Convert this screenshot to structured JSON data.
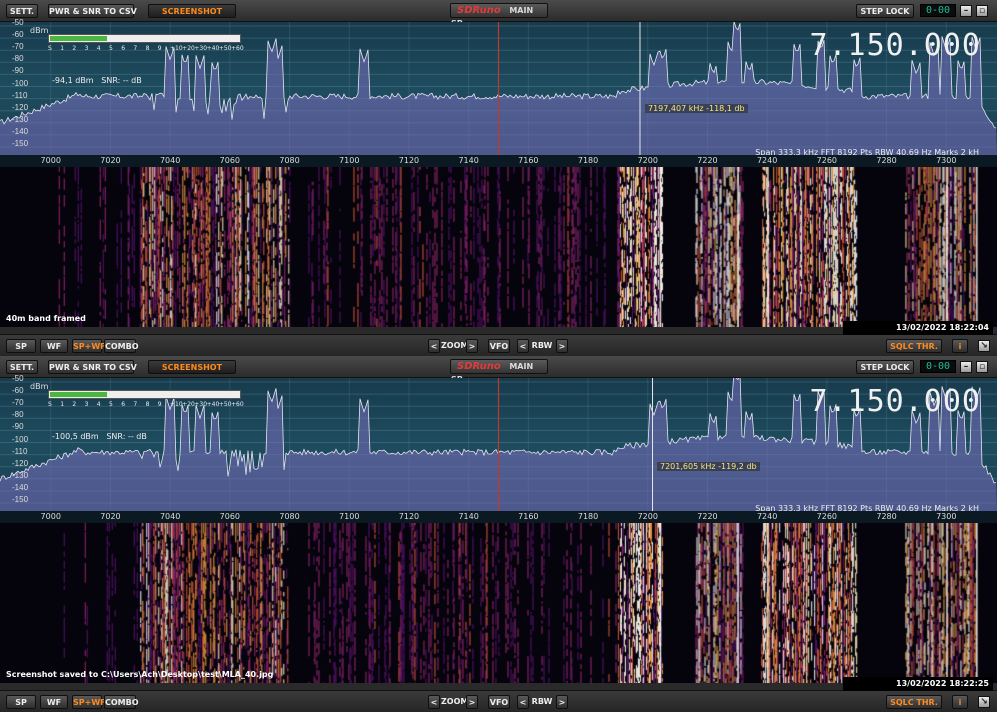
{
  "panels": [
    {
      "toolbar": {
        "settings_label": "SETT.",
        "pwr_snr_label": "PWR & SNR TO CSV",
        "screenshot_label": "SCREENSHOT",
        "logo_text": "SDRuno",
        "main_sp_label": "MAIN SP",
        "step_lock_label": "STEP LOCK",
        "segment_display": "0-00"
      },
      "spectrum": {
        "frequency_display": "7.150.000",
        "dbm_label": "dBm",
        "meter_scale": [
          "S",
          "1",
          "2",
          "3",
          "4",
          "5",
          "6",
          "7",
          "8",
          "9",
          "+10",
          "+20",
          "+30",
          "+40",
          "+50",
          "+60"
        ],
        "meter_level": 0.3,
        "level_readout": "-94,1 dBm",
        "snr_readout": "SNR: -- dB",
        "cursor_readout": "7197,407 kHz -118,1 db",
        "info_line": "Span 333,3 kHz   FFT 8192 Pts   RBW 40,69 Hz   Marks 2 kH",
        "db_scale": [
          "-50",
          "-60",
          "-70",
          "-80",
          "-90",
          "-100",
          "-110",
          "-120",
          "-130",
          "-140",
          "-150"
        ],
        "freq_axis": [
          "7000",
          "7020",
          "7040",
          "7060",
          "7080",
          "7100",
          "7120",
          "7140",
          "7160",
          "7180",
          "7200",
          "7220",
          "7240",
          "7260",
          "7280",
          "7300"
        ],
        "cursor_freq_khz": 7197.4
      },
      "waterfall": {
        "caption": "40m band framed",
        "timestamp": "13/02/2022 18:22:04"
      },
      "bottom": {
        "sp_label": "SP",
        "wf_label": "WF",
        "spwf_label": "SP+WF",
        "combo_label": "COMBO",
        "zoom_label": "ZOOM",
        "vfo_label": "VFO",
        "rbw_label": "RBW",
        "sqlc_label": "SQLC THR.",
        "info_label": "i"
      }
    },
    {
      "toolbar": {
        "settings_label": "SETT.",
        "pwr_snr_label": "PWR & SNR TO CSV",
        "screenshot_label": "SCREENSHOT",
        "logo_text": "SDRuno",
        "main_sp_label": "MAIN SP",
        "step_lock_label": "STEP LOCK",
        "segment_display": "0-00"
      },
      "spectrum": {
        "frequency_display": "7.150.000",
        "dbm_label": "dBm",
        "meter_scale": [
          "S",
          "1",
          "2",
          "3",
          "4",
          "5",
          "6",
          "7",
          "8",
          "9",
          "+10",
          "+20",
          "+30",
          "+40",
          "+50",
          "+60"
        ],
        "meter_level": 0.3,
        "level_readout": "-100,5 dBm",
        "snr_readout": "SNR: -- dB",
        "cursor_readout": "7201,605 kHz -119,2 db",
        "info_line": "Span 333,3 kHz   FFT 8192 Pts   RBW 40,69 Hz   Marks 2 kH",
        "db_scale": [
          "-50",
          "-60",
          "-70",
          "-80",
          "-90",
          "-100",
          "-110",
          "-120",
          "-130",
          "-140",
          "-150"
        ],
        "freq_axis": [
          "7000",
          "7020",
          "7040",
          "7060",
          "7080",
          "7100",
          "7120",
          "7140",
          "7160",
          "7180",
          "7200",
          "7220",
          "7240",
          "7260",
          "7280",
          "7300"
        ],
        "cursor_freq_khz": 7201.6
      },
      "waterfall": {
        "caption": "Screenshot saved to C:\\Users\\Ach\\Desktop\\test\\MLA_40.jpg",
        "timestamp": "13/02/2022 18:22:25"
      },
      "bottom": {
        "sp_label": "SP",
        "wf_label": "WF",
        "spwf_label": "SP+WF",
        "combo_label": "COMBO",
        "zoom_label": "ZOOM",
        "vfo_label": "VFO",
        "rbw_label": "RBW",
        "sqlc_label": "SQLC THR.",
        "info_label": "i"
      }
    }
  ],
  "colors": {
    "accent_orange": "#ff8a1e",
    "segment_green": "#1fbf9a",
    "center_marker": "#c0392b",
    "meter_green": "#4ab83f"
  }
}
